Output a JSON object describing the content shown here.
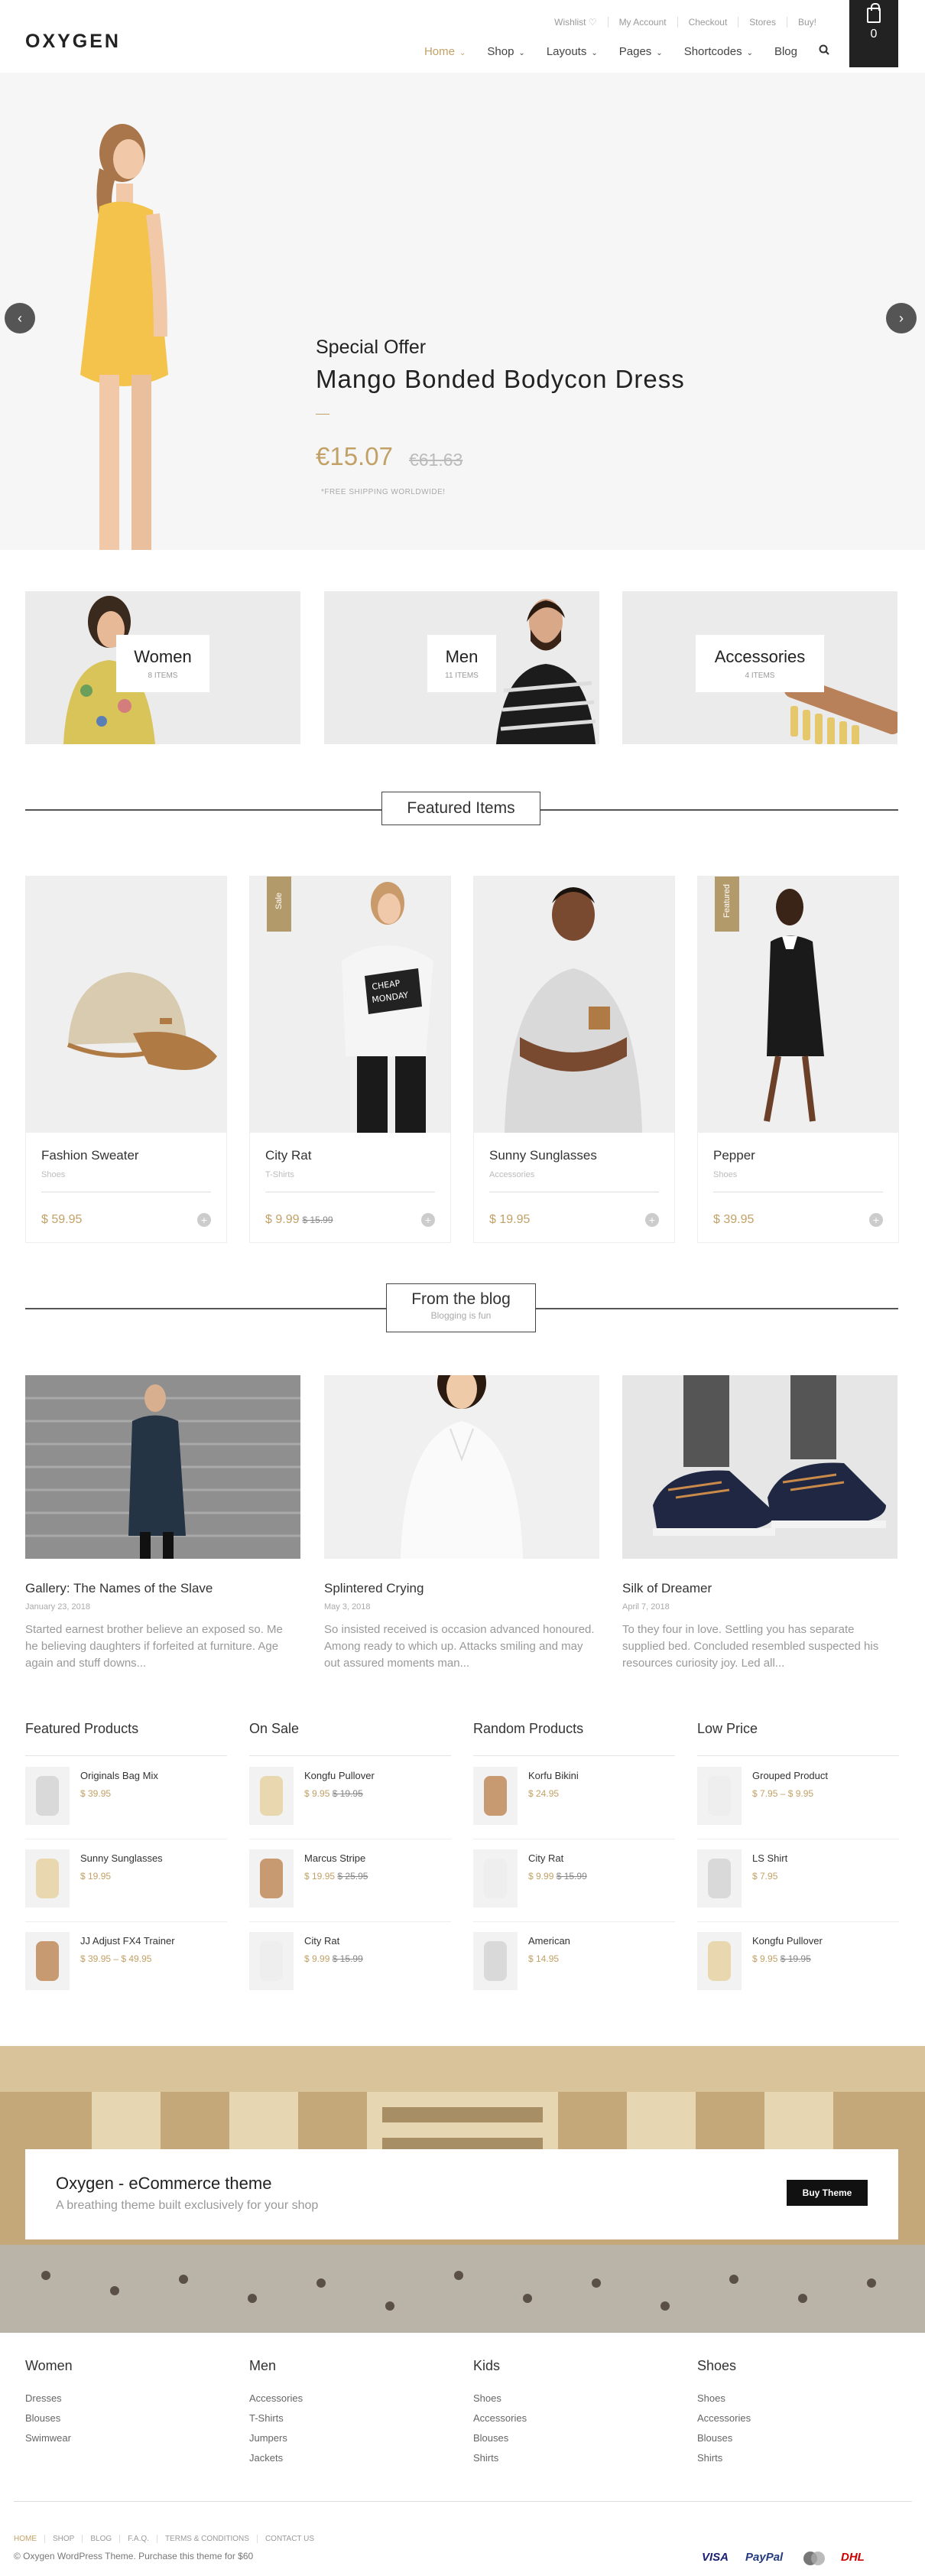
{
  "brand": {
    "logo": "OXYGEN"
  },
  "top_links": [
    "Wishlist ♡",
    "My Account",
    "Checkout",
    "Stores",
    "Buy!"
  ],
  "nav": [
    {
      "label": "Home",
      "dropdown": true,
      "active": true
    },
    {
      "label": "Shop",
      "dropdown": true
    },
    {
      "label": "Layouts",
      "dropdown": true
    },
    {
      "label": "Pages",
      "dropdown": true
    },
    {
      "label": "Shortcodes",
      "dropdown": true
    },
    {
      "label": "Blog",
      "dropdown": false
    }
  ],
  "cart": {
    "count": "0"
  },
  "hero": {
    "kicker": "Special Offer",
    "title": "Mango Bonded Bodycon Dress",
    "price": "€15.07",
    "old_price": "€61.63",
    "shipping": "*FREE SHIPPING WORLDWIDE!",
    "prev_icon": "chevron-left-icon",
    "next_icon": "chevron-right-icon"
  },
  "categories": [
    {
      "name": "Women",
      "count": "8 ITEMS"
    },
    {
      "name": "Men",
      "count": "11 ITEMS"
    },
    {
      "name": "Accessories",
      "count": "4 ITEMS"
    }
  ],
  "featured": {
    "title": "Featured Items",
    "products": [
      {
        "name": "Fashion Sweater",
        "category": "Shoes",
        "price": "$ 59.95",
        "old": "",
        "ribbon": ""
      },
      {
        "name": "City Rat",
        "category": "T-Shirts",
        "price": "$ 9.99",
        "old": "$ 15.99",
        "ribbon": "Sale"
      },
      {
        "name": "Sunny Sunglasses",
        "category": "Accessories",
        "price": "$ 19.95",
        "old": "",
        "ribbon": ""
      },
      {
        "name": "Pepper",
        "category": "Shoes",
        "price": "$ 39.95",
        "old": "",
        "ribbon": "Featured"
      }
    ]
  },
  "blog": {
    "title": "From the blog",
    "subtitle": "Blogging is fun",
    "posts": [
      {
        "title": "Gallery: The Names of the Slave",
        "date": "January 23, 2018",
        "excerpt": "Started earnest brother believe an exposed so. Me he believing daughters if forfeited at furniture. Age again and stuff downs..."
      },
      {
        "title": "Splintered Crying",
        "date": "May 3, 2018",
        "excerpt": "So insisted received is occasion advanced honoured. Among ready to which up. Attacks smiling and may out assured moments man..."
      },
      {
        "title": "Silk of Dreamer",
        "date": "April 7, 2018",
        "excerpt": "To they four in love. Settling you has separate supplied bed. Concluded resembled suspected his resources curiosity joy. Led all..."
      }
    ]
  },
  "widgets": [
    {
      "title": "Featured Products",
      "items": [
        {
          "name": "Originals Bag Mix",
          "price": "$ 39.95",
          "old": ""
        },
        {
          "name": "Sunny Sunglasses",
          "price": "$ 19.95",
          "old": ""
        },
        {
          "name": "JJ Adjust FX4 Trainer",
          "price": "$ 39.95 – $ 49.95",
          "old": ""
        }
      ]
    },
    {
      "title": "On Sale",
      "items": [
        {
          "name": "Kongfu Pullover",
          "price": "$ 9.95",
          "old": "$ 19.95"
        },
        {
          "name": "Marcus Stripe",
          "price": "$ 19.95",
          "old": "$ 25.95"
        },
        {
          "name": "City Rat",
          "price": "$ 9.99",
          "old": "$ 15.99"
        }
      ]
    },
    {
      "title": "Random Products",
      "items": [
        {
          "name": "Korfu Bikini",
          "price": "$ 24.95",
          "old": ""
        },
        {
          "name": "City Rat",
          "price": "$ 9.99",
          "old": "$ 15.99"
        },
        {
          "name": "American",
          "price": "$ 14.95",
          "old": ""
        }
      ]
    },
    {
      "title": "Low Price",
      "items": [
        {
          "name": "Grouped Product",
          "price": "$ 7.95 – $ 9.95",
          "old": ""
        },
        {
          "name": "LS Shirt",
          "price": "$ 7.95",
          "old": ""
        },
        {
          "name": "Kongfu Pullover",
          "price": "$ 9.95",
          "old": "$ 19.95"
        }
      ]
    }
  ],
  "banner": {
    "title": "Oxygen - eCommerce theme",
    "subtitle": "A breathing theme built exclusively for your shop",
    "button": "Buy Theme"
  },
  "footer": {
    "columns": [
      {
        "title": "Women",
        "links": [
          "Dresses",
          "Blouses",
          "Swimwear"
        ]
      },
      {
        "title": "Men",
        "links": [
          "Accessories",
          "T-Shirts",
          "Jumpers",
          "Jackets"
        ]
      },
      {
        "title": "Kids",
        "links": [
          "Shoes",
          "Accessories",
          "Blouses",
          "Shirts"
        ]
      },
      {
        "title": "Shoes",
        "links": [
          "Shoes",
          "Accessories",
          "Blouses",
          "Shirts"
        ]
      }
    ],
    "nav": [
      "HOME",
      "SHOP",
      "BLOG",
      "F.A.Q.",
      "TERMS & CONDITIONS",
      "CONTACT US"
    ],
    "copyright": "© Oxygen WordPress Theme. Purchase this theme for $60",
    "payments": [
      "VISA",
      "PayPal",
      "MasterCard",
      "DHL"
    ]
  },
  "colors": {
    "accent": "#c2a166",
    "dark": "#222222",
    "muted": "#999999"
  }
}
